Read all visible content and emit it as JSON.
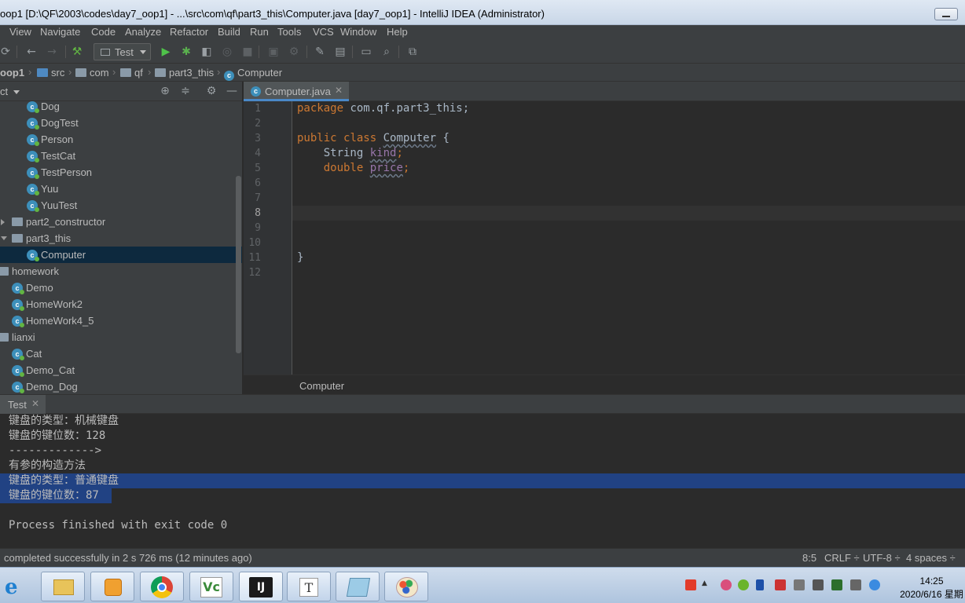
{
  "window": {
    "title": "oop1 [D:\\QF\\2003\\codes\\day7_oop1] - ...\\src\\com\\qf\\part3_this\\Computer.java [day7_oop1] - IntelliJ IDEA (Administrator)"
  },
  "menu": [
    "View",
    "Navigate",
    "Code",
    "Analyze",
    "Refactor",
    "Build",
    "Run",
    "Tools",
    "VCS",
    "Window",
    "Help"
  ],
  "toolbar": {
    "run_config": "Test"
  },
  "breadcrumb": [
    "oop1",
    "src",
    "com",
    "qf",
    "part3_this",
    "Computer"
  ],
  "project": {
    "header": "ct",
    "tree": [
      {
        "label": "Dog",
        "kind": "class"
      },
      {
        "label": "DogTest",
        "kind": "class"
      },
      {
        "label": "Person",
        "kind": "class"
      },
      {
        "label": "TestCat",
        "kind": "class"
      },
      {
        "label": "TestPerson",
        "kind": "class"
      },
      {
        "label": "Yuu",
        "kind": "class"
      },
      {
        "label": "YuuTest",
        "kind": "class"
      },
      {
        "label": "part2_constructor",
        "kind": "folder",
        "state": "collapsed"
      },
      {
        "label": "part3_this",
        "kind": "folder",
        "state": "expanded"
      },
      {
        "label": "Computer",
        "kind": "class",
        "selected": true
      },
      {
        "label": "homework",
        "kind": "folder",
        "state": "expanded"
      },
      {
        "label": "Demo",
        "kind": "class"
      },
      {
        "label": "HomeWork2",
        "kind": "class"
      },
      {
        "label": "HomeWork4_5",
        "kind": "class"
      },
      {
        "label": "lianxi",
        "kind": "folder",
        "state": "expanded"
      },
      {
        "label": "Cat",
        "kind": "class"
      },
      {
        "label": "Demo_Cat",
        "kind": "class"
      },
      {
        "label": "Demo_Dog",
        "kind": "class"
      }
    ]
  },
  "editor": {
    "tab": "Computer.java",
    "line_numbers": [
      "1",
      "2",
      "3",
      "4",
      "5",
      "6",
      "7",
      "8",
      "9",
      "10",
      "11",
      "12"
    ],
    "code": {
      "l1_kw": "package",
      "l1_rest": " com.qf.part3_this;",
      "l3_kw1": "public",
      "l3_kw2": "class",
      "l3_name": "Computer",
      "l3_brace": " {",
      "l4_type": "String",
      "l4_field": "kind",
      "l4_semi": ";",
      "l5_type": "double",
      "l5_field": "price",
      "l5_semi": ";",
      "l11_brace": "}"
    },
    "footer": "Computer",
    "current_line": 8
  },
  "run": {
    "tab": "Test",
    "output": [
      "键盘的类型：机械键盘",
      "键盘的键位数：128",
      "------------->",
      "有参的构造方法",
      "键盘的类型：普通键盘",
      "键盘的键位数：87",
      "",
      "Process finished with exit code 0"
    ]
  },
  "statusbar": {
    "message": "completed successfully in 2 s 726 ms (12 minutes ago)",
    "position": "8:5",
    "line_sep": "CRLF ÷",
    "encoding": "UTF-8 ÷",
    "indent": "4 spaces ÷"
  },
  "taskbar": {
    "time": "14:25",
    "date": "2020/6/16 星期"
  }
}
